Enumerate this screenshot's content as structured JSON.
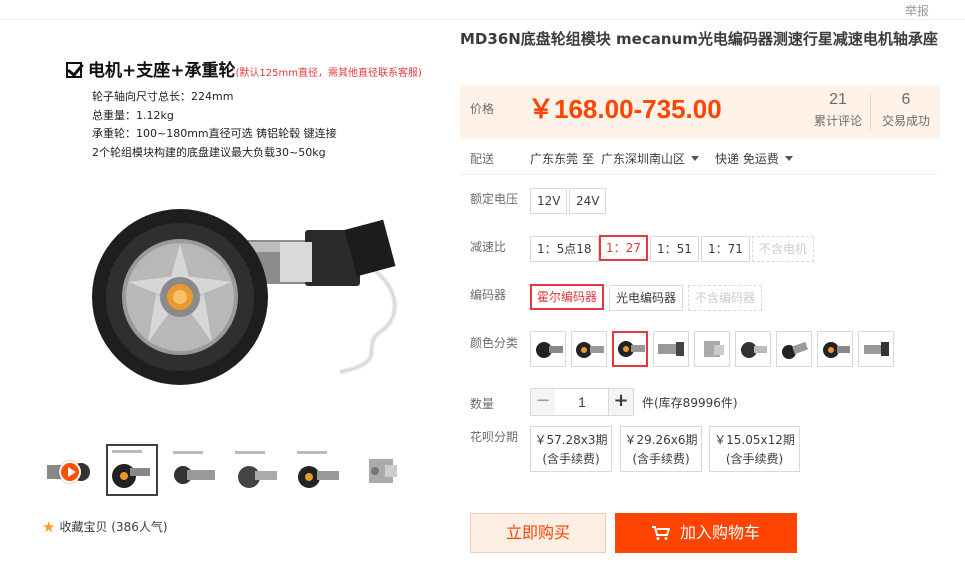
{
  "header": {
    "report_label": "举报"
  },
  "gallery": {
    "promo_heading": "电机+支座+承重轮",
    "promo_note": "(默认125mm直径，需其他直径联系客服)",
    "spec_lines": [
      "轮子轴向尺寸总长：224mm",
      "总重量：1.12kg",
      "承重轮：100~180mm直径可选 铸铝轮毂 键连接",
      "2个轮组模块构建的底盘建议最大负载30~50kg"
    ],
    "thumbnails": [
      {
        "name": "video-thumb",
        "selected": false
      },
      {
        "name": "wheel-motor-assembly",
        "selected": true
      },
      {
        "name": "motor-side-view",
        "selected": false
      },
      {
        "name": "mecanum-wheel-motor",
        "selected": false
      },
      {
        "name": "wheel-motor-top",
        "selected": false
      },
      {
        "name": "gearbox-closeup",
        "selected": false
      }
    ],
    "favorite_label": "收藏宝贝",
    "favorite_count": "(386人气)"
  },
  "product": {
    "title": "MD36N底盘轮组模块 mecanum光电编码器测速行星减速电机轴承座",
    "price_label": "价格",
    "price": "￥168.00-735.00",
    "reviews_count": "21",
    "reviews_label": "累计评论",
    "sales_count": "6",
    "sales_label": "交易成功"
  },
  "shipping": {
    "label": "配送",
    "from": "广东东莞",
    "to_word": "至",
    "to": "广东深圳南山区",
    "method": "快递 免运费"
  },
  "options": {
    "voltage": {
      "label": "额定电压",
      "values": [
        "12V",
        "24V"
      ]
    },
    "ratio": {
      "label": "减速比",
      "values": [
        "1：5点18",
        "1：27",
        "1：51",
        "1：71",
        "不含电机"
      ]
    },
    "encoder": {
      "label": "编码器",
      "values": [
        "霍尔编码器",
        "光电编码器",
        "不含编码器"
      ]
    },
    "color": {
      "label": "颜色分类"
    }
  },
  "quantity": {
    "label": "数量",
    "minus": "−",
    "plus": "+",
    "value": "1",
    "stock_text": "件(库存89996件)"
  },
  "installment": {
    "label": "花呗分期",
    "plans": [
      {
        "amount": "￥57.28x3期",
        "fee": "(含手续费)"
      },
      {
        "amount": "￥29.26x6期",
        "fee": "(含手续费)"
      },
      {
        "amount": "￥15.05x12期",
        "fee": "(含手续费)"
      }
    ]
  },
  "actions": {
    "buy_now": "立即购买",
    "add_to_cart": "加入购物车"
  },
  "colors": {
    "accent": "#ff4400",
    "selected_border": "#e4393c",
    "price_bg": "#fff2e8"
  }
}
